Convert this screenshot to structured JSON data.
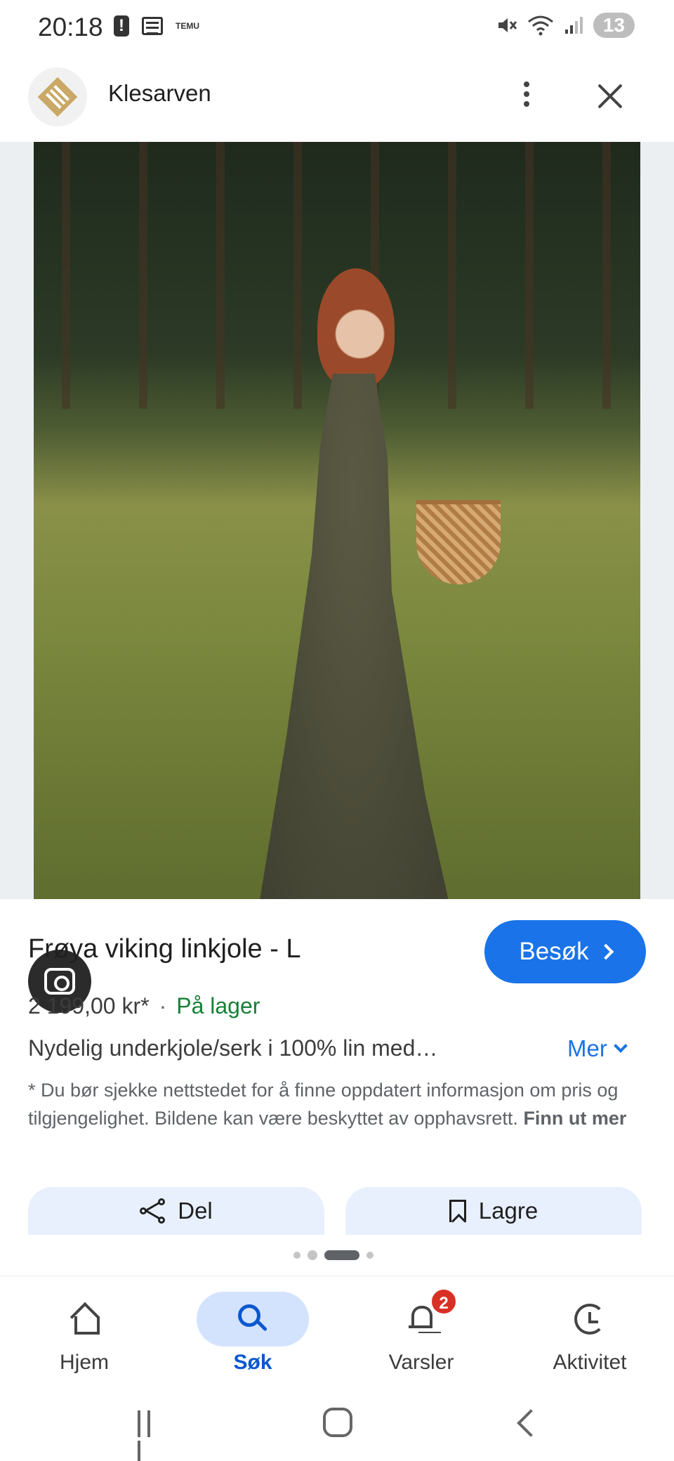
{
  "status_bar": {
    "time": "20:18",
    "temu_label": "TEMU",
    "battery": "13"
  },
  "app_bar": {
    "site_title": "Klesarven"
  },
  "product": {
    "title": "Frøya viking linkjole - L",
    "visit_label": "Besøk",
    "price": "2 199,00 kr*",
    "separator": "·",
    "stock": "På lager",
    "description": "Nydelig underkjole/serk i 100% lin med…",
    "more_label": "Mer",
    "disclaimer": "* Du bør sjekke nettstedet for å finne oppdatert informasjon om pris og tilgjengelighet. Bildene kan være beskyttet av opphavsrett.",
    "learn_more": "Finn ut mer"
  },
  "actions": {
    "share_label": "Del",
    "save_label": "Lagre"
  },
  "bottom_nav": {
    "items": [
      {
        "label": "Hjem",
        "icon": "home-icon"
      },
      {
        "label": "Søk",
        "icon": "search-icon",
        "active": true
      },
      {
        "label": "Varsler",
        "icon": "bell-icon",
        "badge": "2"
      },
      {
        "label": "Aktivitet",
        "icon": "activity-icon"
      }
    ]
  },
  "colors": {
    "accent": "#1a73e8",
    "in_stock": "#188038",
    "active_nav_bg": "#d3e3fd",
    "badge": "#d93025"
  },
  "carousel": {
    "page_count": 4,
    "active_page": 3
  }
}
